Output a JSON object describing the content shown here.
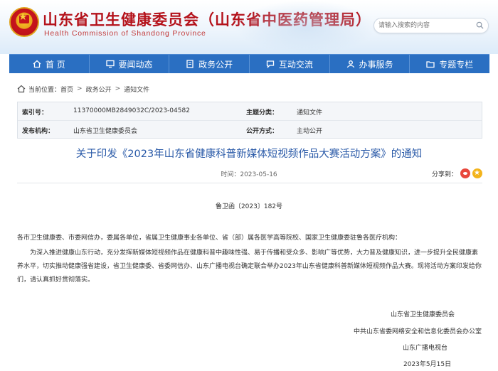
{
  "header": {
    "title": "山东省卫生健康委员会（山东省中医药管理局）",
    "subtitle": "Health Commission of Shandong Province",
    "search_placeholder": "请输入搜索的内容",
    "emblem": "national-emblem"
  },
  "nav": {
    "items": [
      {
        "label": "首 页",
        "icon": "home-icon"
      },
      {
        "label": "要闻动态",
        "icon": "monitor-icon"
      },
      {
        "label": "政务公开",
        "icon": "document-icon"
      },
      {
        "label": "互动交流",
        "icon": "chat-icon"
      },
      {
        "label": "办事服务",
        "icon": "service-icon"
      },
      {
        "label": "专题专栏",
        "icon": "folder-icon"
      }
    ],
    "color": "#2a6fc2"
  },
  "breadcrumb": {
    "prefix": "当前位置：",
    "items": [
      "首页",
      "政务公开",
      "通知文件"
    ],
    "separator": ">"
  },
  "info": {
    "index_label": "索引号：",
    "index_value": "11370000MB2849032C/2023-04582",
    "category_label": "主题分类：",
    "category_value": "通知文件",
    "issuer_label": "发布机构：",
    "issuer_value": "山东省卫生健康委员会",
    "mode_label": "公开方式：",
    "mode_value": "主动公开"
  },
  "document": {
    "title": "关于印发《2023年山东省健康科普新媒体短视频作品大赛活动方案》的通知",
    "date": "时间：2023-05-16",
    "share_label": "分享到：",
    "doc_number": "鲁卫函〔2023〕182号",
    "addressee": "各市卫生健康委、市委网信办，委属各单位，省属卫生健康事业各单位、省（部）属各医学高等院校、国家卫生健康委驻鲁各医疗机构：",
    "paragraph": "为深入推进健康山东行动，充分发挥新媒体短视频作品在健康科普中趣味性强、易于传播和受众多、影响广等优势，大力普及健康知识，进一步提升全民健康素养水平，切实推动健康强省建设，省卫生健康委、省委网信办、山东广播电视台确定联合举办2023年山东省健康科普新媒体短视频作品大赛。现将活动方案印发给你们，请认真抓好贯彻落实。",
    "signatures": [
      "山东省卫生健康委员会",
      "中共山东省委网络安全和信息化委员会办公室",
      "山东广播电视台",
      "2023年5月15日"
    ]
  }
}
